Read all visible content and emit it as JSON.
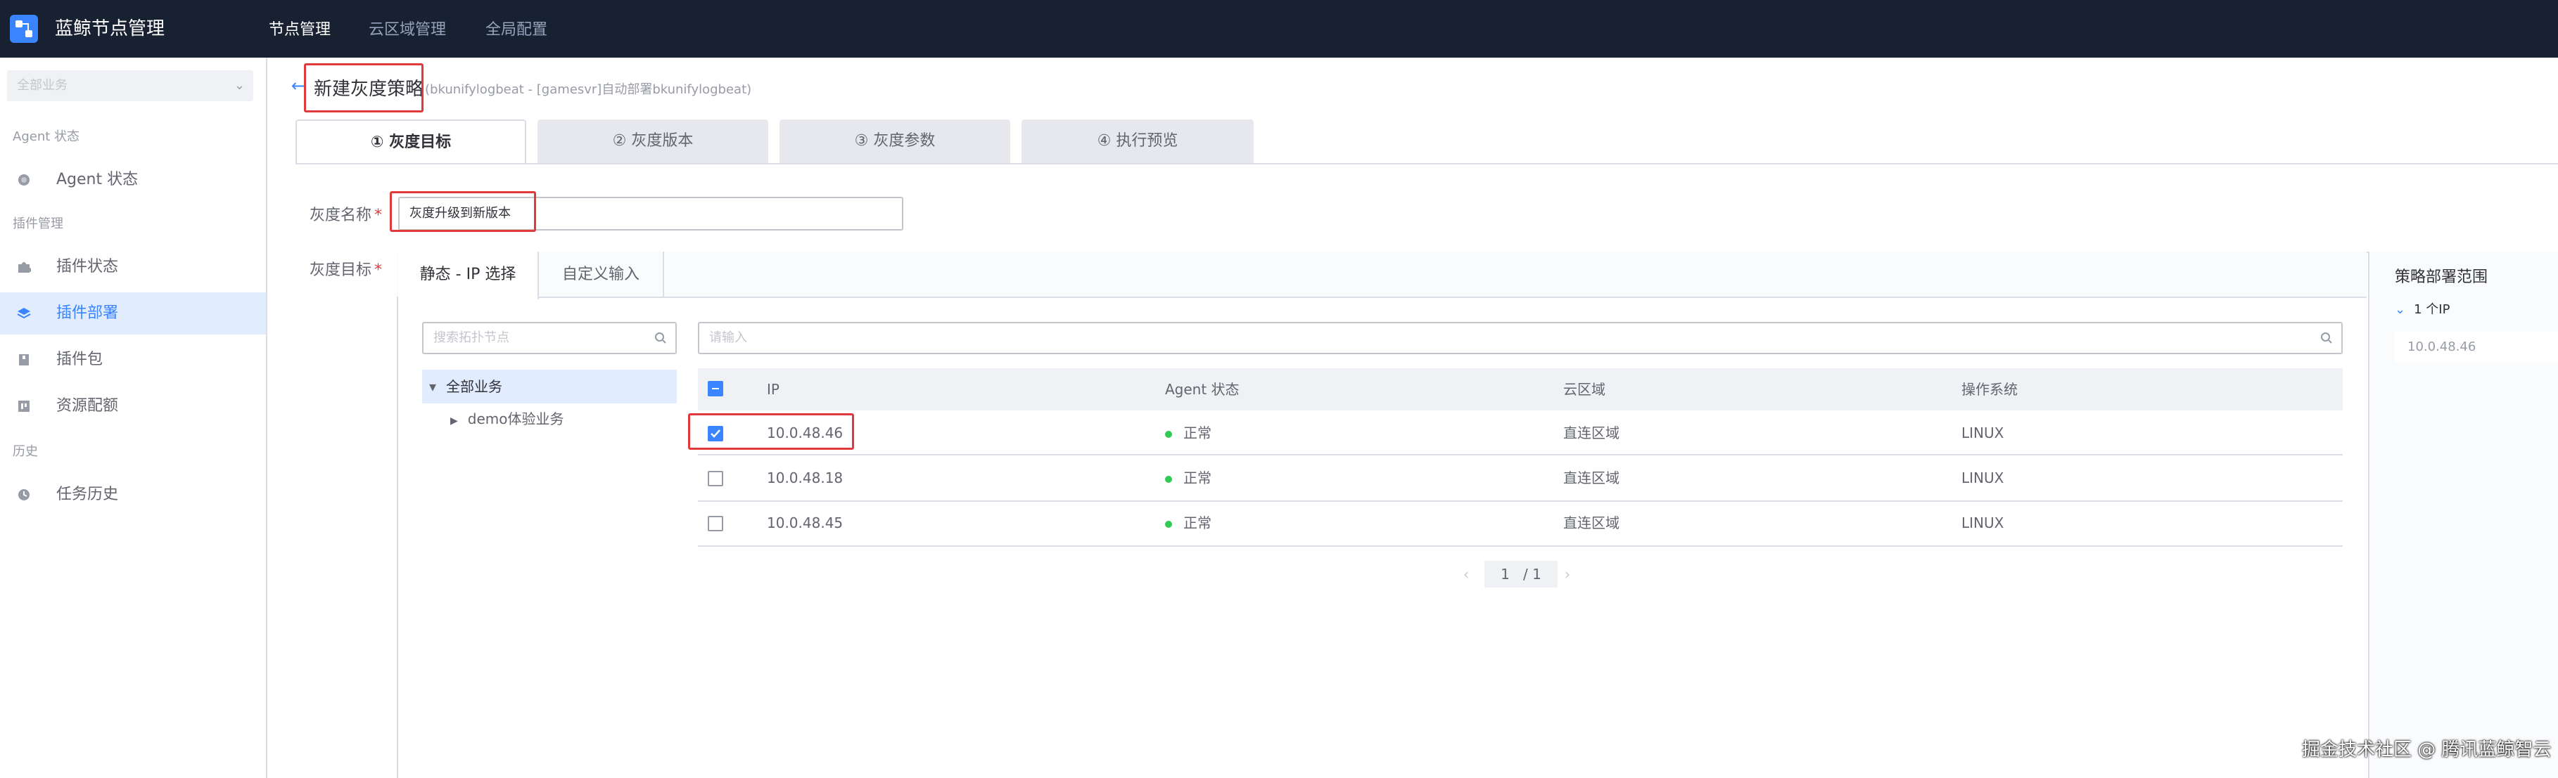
{
  "topbar": {
    "app_title": "蓝鲸节点管理",
    "nav": [
      "节点管理",
      "云区域管理",
      "全局配置"
    ]
  },
  "sidebar": {
    "business_select": "全部业务",
    "groups": {
      "agent": "Agent 状态",
      "plugin": "插件管理",
      "history": "历史"
    },
    "items": [
      {
        "label": "Agent 状态",
        "icon": "circle-dot-icon"
      },
      {
        "label": "插件状态",
        "icon": "puzzle-icon"
      },
      {
        "label": "插件部署",
        "icon": "layers-icon"
      },
      {
        "label": "插件包",
        "icon": "package-icon"
      },
      {
        "label": "资源配额",
        "icon": "grid-icon"
      },
      {
        "label": "任务历史",
        "icon": "clock-icon"
      }
    ]
  },
  "header": {
    "title": "新建灰度策略",
    "subtitle": "(bkunifylogbeat - [gamesvr]自动部署bkunifylogbeat)"
  },
  "steps": [
    "① 灰度目标",
    "② 灰度版本",
    "③ 灰度参数",
    "④ 执行预览"
  ],
  "form": {
    "name_label": "灰度名称",
    "name_value": "灰度升级到新版本",
    "target_label": "灰度目标",
    "required_mark": "*"
  },
  "target_tabs": [
    "静态 - IP 选择",
    "自定义输入"
  ],
  "tree": {
    "search_placeholder": "搜索拓扑节点",
    "root": "全部业务",
    "child": "demo体验业务"
  },
  "table": {
    "search_placeholder": "请输入",
    "columns": [
      "IP",
      "Agent 状态",
      "云区域",
      "操作系统"
    ],
    "rows": [
      {
        "ip": "10.0.48.46",
        "status": "正常",
        "cloud": "直连区域",
        "os": "LINUX",
        "checked": true
      },
      {
        "ip": "10.0.48.18",
        "status": "正常",
        "cloud": "直连区域",
        "os": "LINUX",
        "checked": false
      },
      {
        "ip": "10.0.48.45",
        "status": "正常",
        "cloud": "直连区域",
        "os": "LINUX",
        "checked": false
      }
    ],
    "pager": {
      "current": "1",
      "total": "/ 1"
    }
  },
  "scope": {
    "title": "策略部署范围",
    "count": "1 个IP",
    "ip": "10.0.48.46"
  },
  "watermark": "掘金技术社区 @ 腾讯蓝鲸智云",
  "colors": {
    "accent": "#3a84ff",
    "highlight": "#e03a3a",
    "topbar": "#182132",
    "ok": "#2dcb56"
  }
}
